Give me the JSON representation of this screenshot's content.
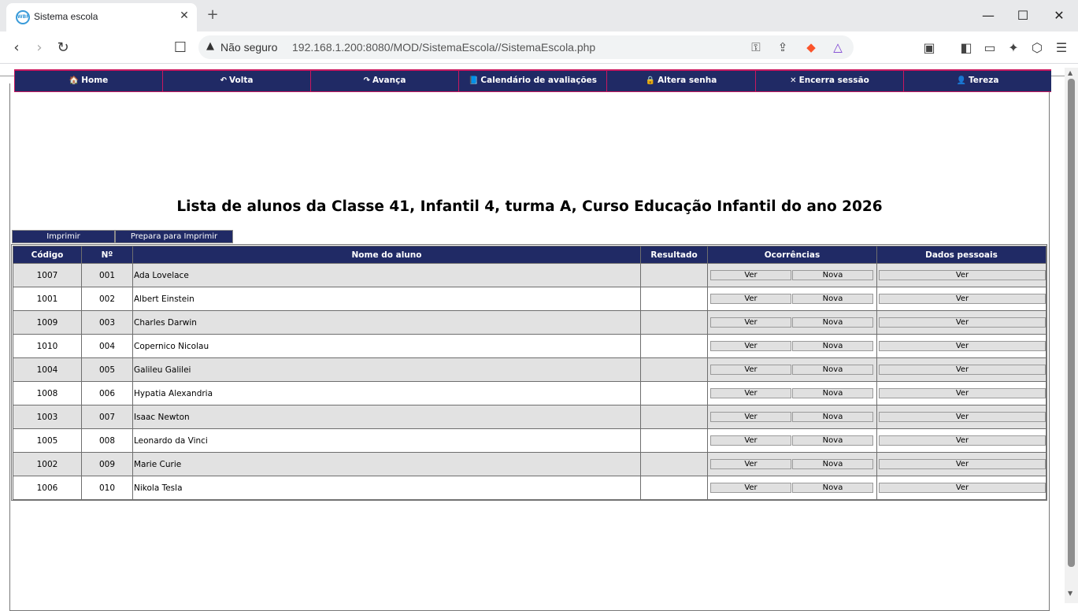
{
  "browser": {
    "tab_title": "Sistema escola",
    "tab_favicon": "WBF",
    "tab_close": "✕",
    "new_tab": "+",
    "security_label": "Não seguro",
    "url": "192.168.1.200:8080/MOD/SistemaEscola//SistemaEscola.php",
    "window_minimize": "—",
    "window_maximize": "☐",
    "window_close": "✕"
  },
  "menu": [
    {
      "label": "Home",
      "icon": "🏠",
      "icon_name": "home-icon"
    },
    {
      "label": "Volta",
      "icon": "↶",
      "icon_name": "back-arrow-icon"
    },
    {
      "label": "Avança",
      "icon": "↷",
      "icon_name": "forward-arrow-icon"
    },
    {
      "label": "Calendário de avaliações",
      "icon": "📘",
      "icon_name": "calendar-book-icon"
    },
    {
      "label": "Altera senha",
      "icon": "🔒",
      "icon_name": "lock-icon"
    },
    {
      "label": "Encerra sessão",
      "icon": "✕",
      "icon_name": "close-session-icon"
    },
    {
      "label": "Tereza",
      "icon": "👤",
      "icon_name": "user-icon"
    }
  ],
  "page_title": "Lista de alunos da Classe 41, Infantil 4, turma A, Curso Educação Infantil do ano 2026",
  "actions": {
    "print": "Imprimir",
    "prepare_print": "Prepara para Imprimir"
  },
  "table": {
    "headers": [
      "Código",
      "Nº",
      "Nome do aluno",
      "Resultado",
      "Ocorrências",
      "Dados pessoais"
    ],
    "button_ver": "Ver",
    "button_nova": "Nova",
    "rows": [
      {
        "codigo": "1007",
        "numero": "001",
        "nome": "Ada Lovelace",
        "resultado": ""
      },
      {
        "codigo": "1001",
        "numero": "002",
        "nome": "Albert Einstein",
        "resultado": ""
      },
      {
        "codigo": "1009",
        "numero": "003",
        "nome": "Charles Darwin",
        "resultado": ""
      },
      {
        "codigo": "1010",
        "numero": "004",
        "nome": "Copernico Nicolau",
        "resultado": ""
      },
      {
        "codigo": "1004",
        "numero": "005",
        "nome": "Galileu Galilei",
        "resultado": ""
      },
      {
        "codigo": "1008",
        "numero": "006",
        "nome": "Hypatia Alexandria",
        "resultado": ""
      },
      {
        "codigo": "1003",
        "numero": "007",
        "nome": "Isaac Newton",
        "resultado": ""
      },
      {
        "codigo": "1005",
        "numero": "008",
        "nome": "Leonardo da Vinci",
        "resultado": ""
      },
      {
        "codigo": "1002",
        "numero": "009",
        "nome": "Marie Curie",
        "resultado": ""
      },
      {
        "codigo": "1006",
        "numero": "010",
        "nome": "Nikola Tesla",
        "resultado": ""
      }
    ]
  },
  "colors": {
    "menu_bg": "#202a65",
    "menu_border": "#c9185f",
    "row_alt": "#e2e2e2"
  }
}
